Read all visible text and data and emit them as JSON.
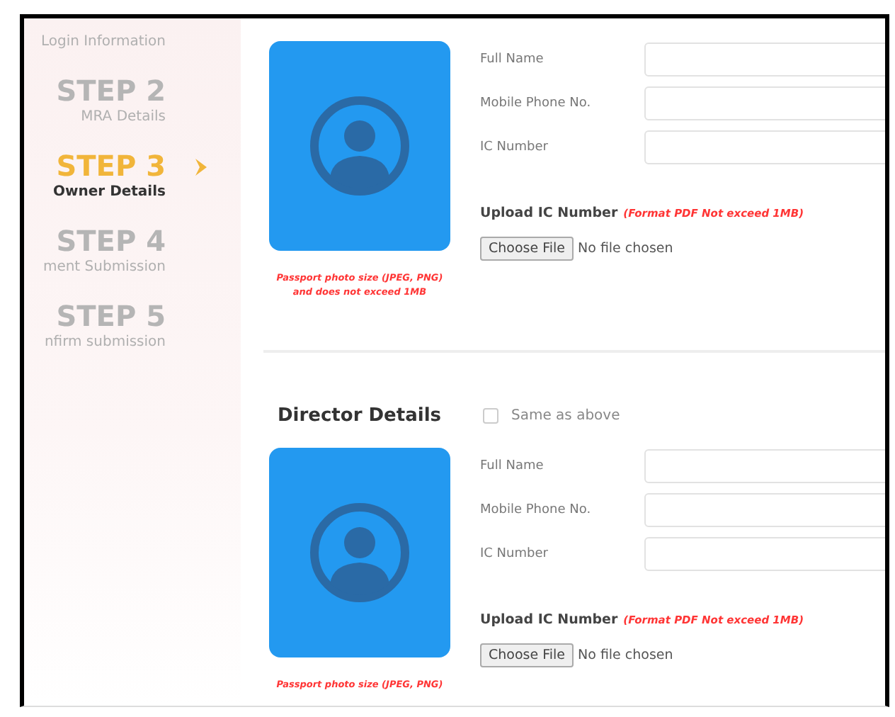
{
  "steps": [
    {
      "label": "Login Information",
      "selected": false
    },
    {
      "step": "STEP 2",
      "label": "MRA Details",
      "selected": false
    },
    {
      "step": "STEP 3",
      "label": "Owner Details",
      "selected": true
    },
    {
      "step": "STEP 4",
      "label": "ment Submission",
      "selected": false
    },
    {
      "step": "STEP 5",
      "label": "nfirm submission",
      "selected": false
    }
  ],
  "sections": [
    {
      "fields": [
        {
          "label": "Full Name"
        },
        {
          "label": "Mobile Phone No."
        },
        {
          "label": "IC Number"
        }
      ],
      "upload": {
        "label": "Upload IC Number",
        "note": "(Format PDF Not exceed 1MB)",
        "button": "Choose File",
        "status": "No file chosen"
      },
      "photo_caption": [
        "Passport photo size (JPEG, PNG)",
        "and does not exceed 1MB"
      ]
    },
    {
      "title": "Director Details",
      "same_as_above": {
        "label": "Same as above",
        "checked": false
      },
      "fields": [
        {
          "label": "Full Name"
        },
        {
          "label": "Mobile Phone No."
        },
        {
          "label": "IC Number"
        }
      ],
      "upload": {
        "label": "Upload IC Number",
        "note": "(Format PDF Not exceed 1MB)",
        "button": "Choose File",
        "status": "No file chosen"
      },
      "photo_caption": [
        "Passport photo size (JPEG, PNG)"
      ]
    }
  ]
}
